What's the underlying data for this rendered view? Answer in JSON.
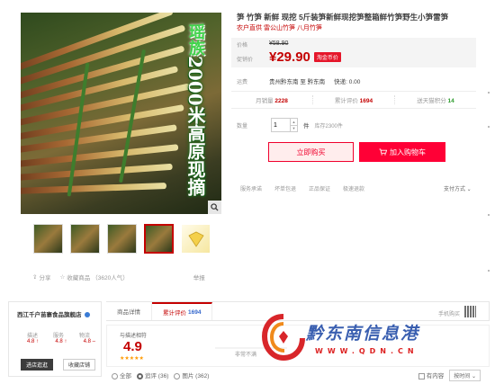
{
  "product": {
    "title": "笋 竹笋 新鲜 现挖 5斤装笋新鲜现挖笋整箱鲜竹笋野生小笋雷笋",
    "subtitle": "农户直供 雷公山竹笋 八月竹笋",
    "overlay_text_line1": "瑶",
    "overlay_text_line2": "族",
    "overlay_text_vertical": "2000米高原现摘",
    "overlay_lead_char": "瑶族"
  },
  "price": {
    "original_label": "价格",
    "original_value": "¥58.90",
    "promo_label": "促销价",
    "promo_value": "¥29.90",
    "promo_badge": "淘金币价"
  },
  "shipping": {
    "label": "运费",
    "route": "贵州黔东南 至 黔东南",
    "express": "快递: 0.00"
  },
  "stats": {
    "monthly_label": "月销量",
    "monthly_value": "2228",
    "reviews_label": "累计评价",
    "reviews_value": "1694",
    "coins_label": "送天猫积分",
    "coins_value": "14"
  },
  "quantity": {
    "label": "数量",
    "value": "1",
    "unit": "件",
    "stock": "库存2300件"
  },
  "buttons": {
    "buy_now": "立即购买",
    "add_cart": "加入购物车"
  },
  "promise": {
    "label": "服务承诺",
    "items": [
      "坏单包退",
      "正品保证",
      "极速退款"
    ],
    "payment": "支付方式 ⌄"
  },
  "share": {
    "share": "分享",
    "favorite": "收藏商品",
    "popularity": "（3620人气）",
    "report": "举报"
  },
  "shop": {
    "name": "西江千户苗寨食品旗舰店",
    "rating_labels": [
      "描述",
      "服务",
      "物流"
    ],
    "rating_values": [
      "4.8 ↑",
      "4.8 ↑",
      "4.8 –"
    ],
    "enter_button": "进店逛逛",
    "fav_button": "收藏店铺"
  },
  "tabs": {
    "items": [
      "商品详情",
      "累计评价",
      "手机购买"
    ],
    "review_count": "1694"
  },
  "reviews": {
    "label": "与描述相符",
    "score": "4.9",
    "stars": "★★★★★",
    "scale_hint": "非常不满"
  },
  "filters": {
    "all": "全部",
    "append": "追评 (36)",
    "images": "图片 (362)",
    "has_content": "有内容",
    "sort": "按时间 ⌄"
  },
  "watermark": {
    "text": "黔东南信息港",
    "url": "WWW.QDN.CN"
  },
  "colors": {
    "accent": "#c40000",
    "buy_button": "#ff0036",
    "promo_badge": "#e5162a"
  }
}
